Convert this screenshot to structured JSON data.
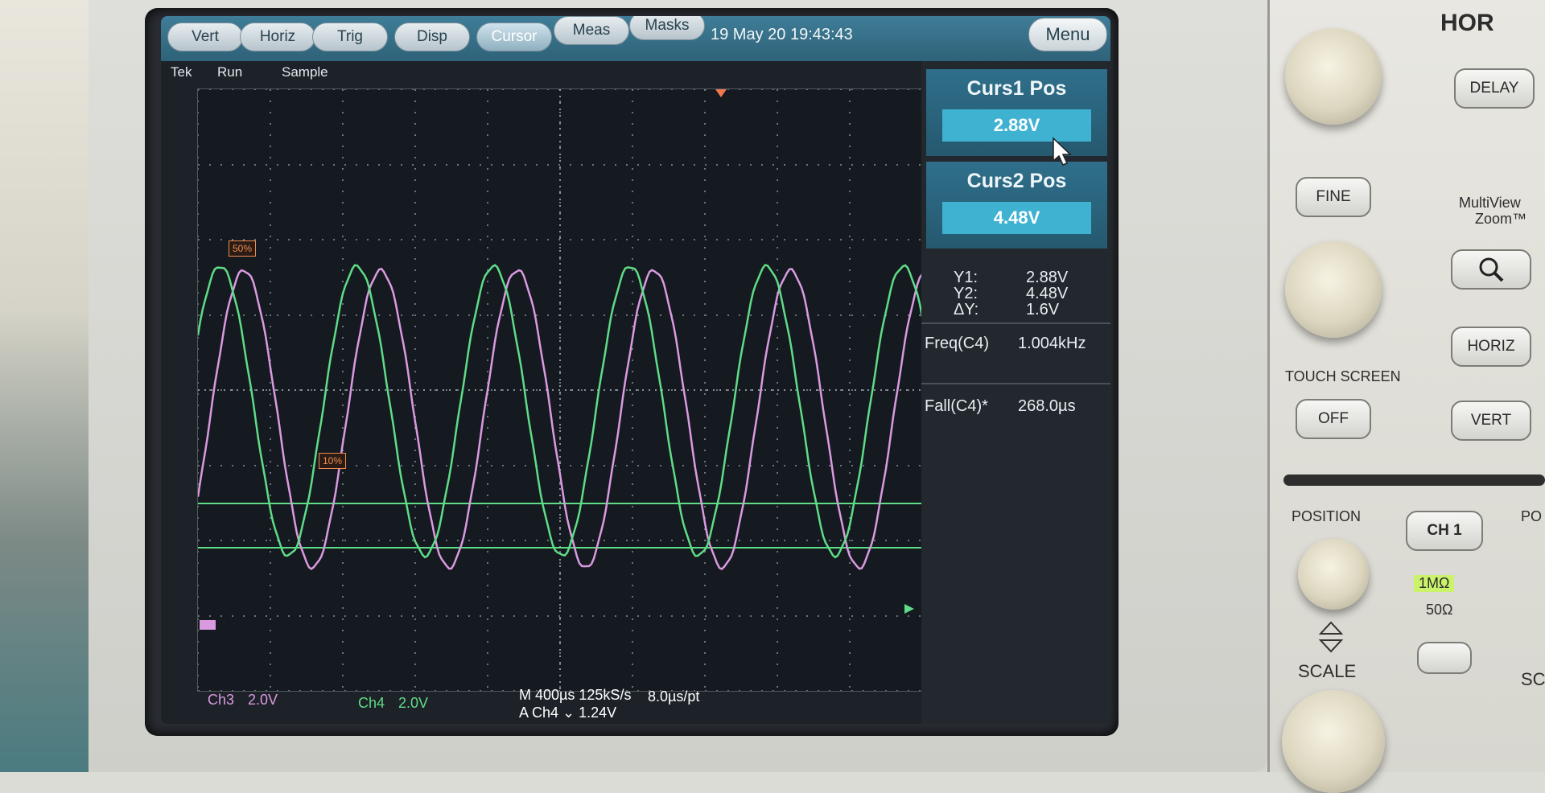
{
  "menubar": {
    "keys": [
      "Vert",
      "Horiz",
      "Trig",
      "Disp",
      "Cursor",
      "Meas",
      "Masks"
    ],
    "datetime": "19 May 20 19:43:43",
    "menu_label": "Menu"
  },
  "status": {
    "brand": "Tek",
    "run": "Run",
    "mode": "Sample"
  },
  "markers": {
    "ch3_ref": "50%",
    "ch4_ref": "10%"
  },
  "readout": {
    "curs1_title": "Curs1 Pos",
    "curs1_value": "2.88V",
    "curs2_title": "Curs2 Pos",
    "curs2_value": "4.48V",
    "y1_label": "Y1:",
    "y1_value": "2.88V",
    "y2_label": "Y2:",
    "y2_value": "4.48V",
    "dy_label": "ΔY:",
    "dy_value": "1.6V",
    "freq_label": "Freq(C4)",
    "freq_value": "1.004kHz",
    "fall_label": "Fall(C4)*",
    "fall_value": "268.0µs"
  },
  "bottom": {
    "ch3_label": "Ch3",
    "ch3_scale": "2.0V",
    "ch4_label": "Ch4",
    "ch4_scale": "2.0V",
    "timebase": "M 400µs 125kS/s",
    "per_point": "8.0µs/pt",
    "trigger": "A  Ch4  ⌄  1.24V"
  },
  "panel": {
    "horiz_heading": "HOR",
    "delay": "DELAY",
    "fine": "FINE",
    "multiview": "MultiView",
    "zoom": "Zoom™",
    "horiz": "HORIZ",
    "vert": "VERT",
    "touch_screen": "TOUCH SCREEN",
    "off": "OFF",
    "position": "POSITION",
    "ch1": "CH 1",
    "imp_1m": "1MΩ",
    "imp_50": "50Ω",
    "scale": "SCALE",
    "po": "PO",
    "sc": "SC"
  },
  "colors": {
    "ch3": "#d99ae0",
    "ch4": "#5fdc86",
    "cursor": "#5fdc86",
    "accent": "#3fb2d1"
  },
  "icons": [
    "search-icon",
    "cursor-pointer-icon",
    "updown-arrows-icon",
    "trigger-marker-icon",
    "ground-marker-icon"
  ]
}
